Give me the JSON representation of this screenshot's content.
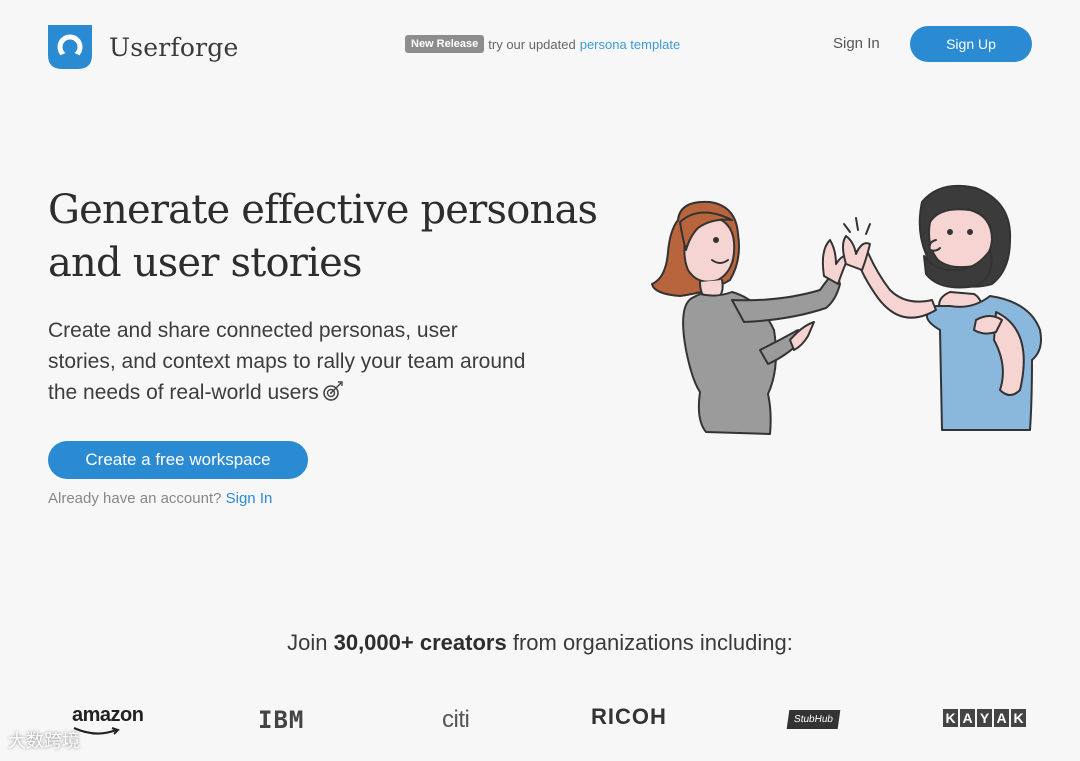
{
  "brand": {
    "name": "Userforge",
    "accent": "#2b8bd2"
  },
  "release": {
    "badge": "New Release",
    "text": "try our updated",
    "link": "persona template"
  },
  "nav": {
    "signin": "Sign In",
    "signup": "Sign Up"
  },
  "hero": {
    "title_line1": "Generate effective personas",
    "title_line2": "and user stories",
    "subtitle": "Create and share connected personas, user stories, and context maps to rally your team around the needs of real-world users",
    "cta": "Create a free workspace",
    "account_prompt": "Already have an account?",
    "account_link": "Sign In"
  },
  "join": {
    "prefix": "Join",
    "count": "30,000+",
    "creators": "creators",
    "suffix": "from organizations including:"
  },
  "organizations": [
    "amazon",
    "IBM",
    "citi",
    "RICOH",
    "StubHub",
    "KAYAK"
  ],
  "watermark": "大数跨境",
  "icons": [
    "logo-mark-icon",
    "dartboard-icon"
  ]
}
